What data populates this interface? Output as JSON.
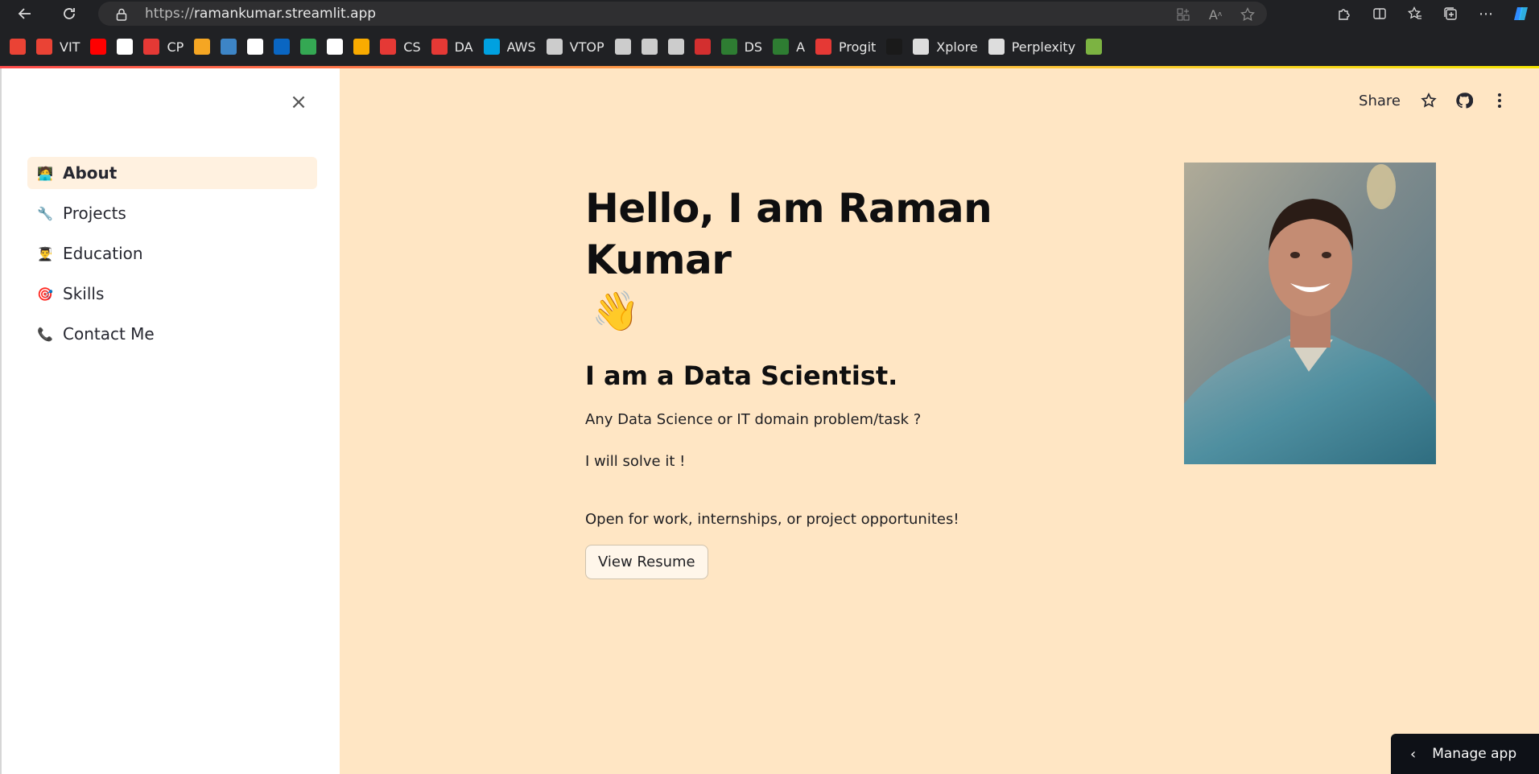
{
  "browser": {
    "url_prefix": "https://",
    "url_domain": "ramankumar.streamlit.app",
    "icons": [
      "back-icon",
      "refresh-icon",
      "lock-icon",
      "apps-icon",
      "read-aloud-icon",
      "favorite-star-icon",
      "extensions-icon",
      "split-screen-icon",
      "favorites-icon",
      "collections-icon",
      "more-icon",
      "copilot-icon"
    ]
  },
  "bookmarks": [
    {
      "label": "",
      "icon": "gmail-icon",
      "color": "#ea4335"
    },
    {
      "label": "VIT",
      "icon": "gmail-icon",
      "color": "#ea4335"
    },
    {
      "label": "",
      "icon": "youtube-icon",
      "color": "#ff0000"
    },
    {
      "label": "",
      "icon": "github-icon",
      "color": "#ffffff"
    },
    {
      "label": "CP",
      "icon": "pdf-icon",
      "color": "#e53935"
    },
    {
      "label": "",
      "icon": "codeforces-icon",
      "color": "#f5a623"
    },
    {
      "label": "",
      "icon": "chart-icon",
      "color": "#3d85c6"
    },
    {
      "label": "",
      "icon": "vidyalankar-icon",
      "color": "#ffffff"
    },
    {
      "label": "",
      "icon": "linkedin-icon",
      "color": "#0a66c2"
    },
    {
      "label": "",
      "icon": "google-icon",
      "color": "#34a853"
    },
    {
      "label": "",
      "icon": "chatgpt-icon",
      "color": "#ffffff"
    },
    {
      "label": "",
      "icon": "colab-icon",
      "color": "#f9ab00"
    },
    {
      "label": "CS",
      "icon": "pdf-icon",
      "color": "#e53935"
    },
    {
      "label": "DA",
      "icon": "pdf-icon",
      "color": "#e53935"
    },
    {
      "label": "AWS",
      "icon": "salesforce-icon",
      "color": "#00a1e0"
    },
    {
      "label": "VTOP",
      "icon": "vtop-icon",
      "color": "#cccccc"
    },
    {
      "label": "",
      "icon": "vit-portal-icon",
      "color": "#cccccc"
    },
    {
      "label": "",
      "icon": "vit-portal-icon",
      "color": "#cccccc"
    },
    {
      "label": "",
      "icon": "vit-portal-icon",
      "color": "#cccccc"
    },
    {
      "label": "",
      "icon": "speedometer-icon",
      "color": "#d32f2f"
    },
    {
      "label": "DS",
      "icon": "infinity-icon",
      "color": "#2e7d32"
    },
    {
      "label": "A",
      "icon": "infinity-icon",
      "color": "#2e7d32"
    },
    {
      "label": "Progit",
      "icon": "pdf-icon",
      "color": "#e53935"
    },
    {
      "label": "",
      "icon": "ship-icon",
      "color": "#1a1a1a"
    },
    {
      "label": "Xplore",
      "icon": "file-icon",
      "color": "#dddddd"
    },
    {
      "label": "Perplexity",
      "icon": "perplexity-icon",
      "color": "#dddddd"
    },
    {
      "label": "",
      "icon": "chess-icon",
      "color": "#7cb342"
    }
  ],
  "sidebar": {
    "close": "×",
    "items": [
      {
        "label": "About",
        "emoji": "🧑‍💻",
        "active": true
      },
      {
        "label": "Projects",
        "emoji": "🔧",
        "active": false
      },
      {
        "label": "Education",
        "emoji": "👨‍🎓",
        "active": false
      },
      {
        "label": "Skills",
        "emoji": "🎯",
        "active": false
      },
      {
        "label": "Contact Me",
        "emoji": "📞",
        "active": false
      }
    ]
  },
  "header": {
    "share": "Share"
  },
  "main": {
    "title": "Hello, I am Raman Kumar",
    "wave": "👋",
    "subtitle": "I am a Data Scientist.",
    "line1": "Any Data Science or IT domain problem/task ?",
    "line2": "I will solve it !",
    "line3": "Open for work, internships, or project opportunites!",
    "button": "View Resume"
  },
  "manage_app": {
    "label": "Manage app",
    "chevron": "‹"
  },
  "colors": {
    "app_bg": "#ffe6c4",
    "sidebar_bg": "#ffffff",
    "active_item_bg": "#fff1e0",
    "browser_chrome": "#202124"
  }
}
